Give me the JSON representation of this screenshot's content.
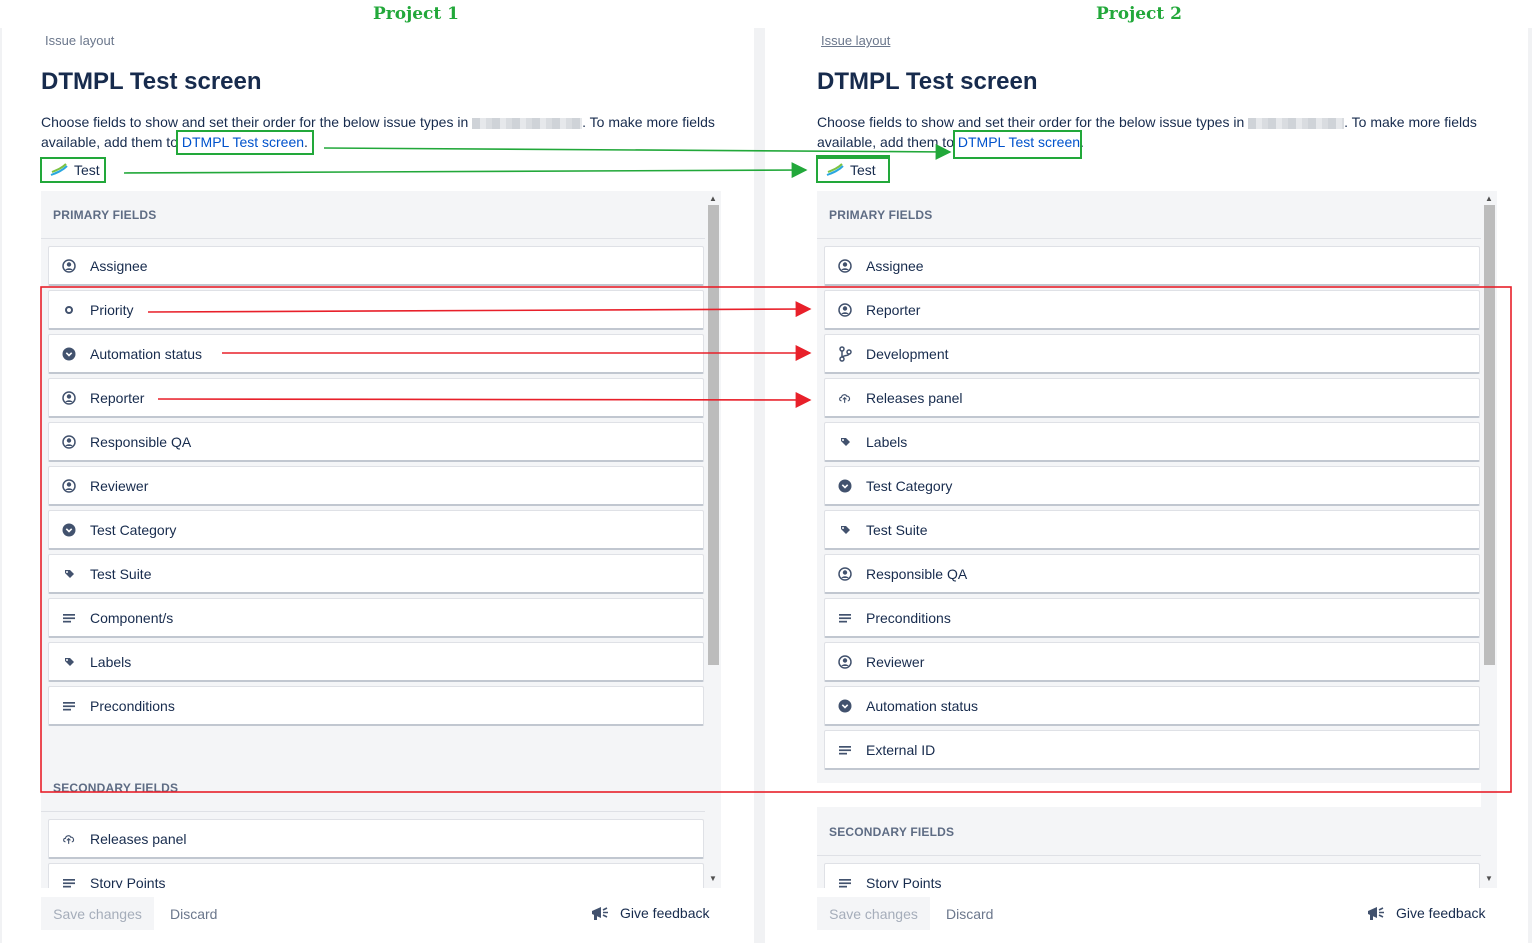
{
  "annotations": {
    "project1_label": "Project 1",
    "project2_label": "Project 2"
  },
  "colors": {
    "annotation_green": "#22a83a",
    "annotation_red": "#e8202a",
    "link": "#0052cc",
    "text": "#172b4d"
  },
  "project1": {
    "breadcrumb": "Issue layout",
    "title": "DTMPL Test screen",
    "desc_before": "Choose fields to show and set their order for the below issue types in",
    "desc_after": ". To make more fields available, add them to",
    "screen_link": "DTMPL Test screen",
    "issue_type": "Test",
    "primary_header": "PRIMARY FIELDS",
    "primary_fields": [
      {
        "label": "Assignee",
        "icon": "person-icon"
      },
      {
        "label": "Priority",
        "icon": "priority-dot-icon"
      },
      {
        "label": "Automation status",
        "icon": "dropdown-circle-icon"
      },
      {
        "label": "Reporter",
        "icon": "person-icon"
      },
      {
        "label": "Responsible QA",
        "icon": "person-icon"
      },
      {
        "label": "Reviewer",
        "icon": "person-icon"
      },
      {
        "label": "Test Category",
        "icon": "dropdown-circle-icon"
      },
      {
        "label": "Test Suite",
        "icon": "tag-icon"
      },
      {
        "label": "Component/s",
        "icon": "text-lines-icon"
      },
      {
        "label": "Labels",
        "icon": "tag-icon"
      },
      {
        "label": "Preconditions",
        "icon": "text-lines-icon"
      }
    ],
    "secondary_header": "SECONDARY FIELDS",
    "secondary_fields": [
      {
        "label": "Releases panel",
        "icon": "cloud-upload-icon"
      },
      {
        "label": "Story Points",
        "icon": "text-lines-icon"
      }
    ],
    "save_label": "Save changes",
    "discard_label": "Discard",
    "feedback_label": "Give feedback"
  },
  "project2": {
    "breadcrumb": "Issue layout",
    "title": "DTMPL Test screen",
    "desc_before": "Choose fields to show and set their order for the below issue types in",
    "desc_after": ". To make more fields available, add them to",
    "screen_link": "DTMPL Test screen",
    "issue_type": "Test",
    "primary_header": "PRIMARY FIELDS",
    "primary_fields": [
      {
        "label": "Assignee",
        "icon": "person-icon"
      },
      {
        "label": "Reporter",
        "icon": "person-icon"
      },
      {
        "label": "Development",
        "icon": "branch-icon"
      },
      {
        "label": "Releases panel",
        "icon": "cloud-upload-icon"
      },
      {
        "label": "Labels",
        "icon": "tag-icon"
      },
      {
        "label": "Test Category",
        "icon": "dropdown-circle-icon"
      },
      {
        "label": "Test Suite",
        "icon": "tag-icon"
      },
      {
        "label": "Responsible QA",
        "icon": "person-icon"
      },
      {
        "label": "Preconditions",
        "icon": "text-lines-icon"
      },
      {
        "label": "Reviewer",
        "icon": "person-icon"
      },
      {
        "label": "Automation status",
        "icon": "dropdown-circle-icon"
      },
      {
        "label": "External ID",
        "icon": "text-lines-icon"
      }
    ],
    "secondary_header": "SECONDARY FIELDS",
    "secondary_fields": [
      {
        "label": "Story Points",
        "icon": "text-lines-icon"
      }
    ],
    "save_label": "Save changes",
    "discard_label": "Discard",
    "feedback_label": "Give feedback"
  }
}
